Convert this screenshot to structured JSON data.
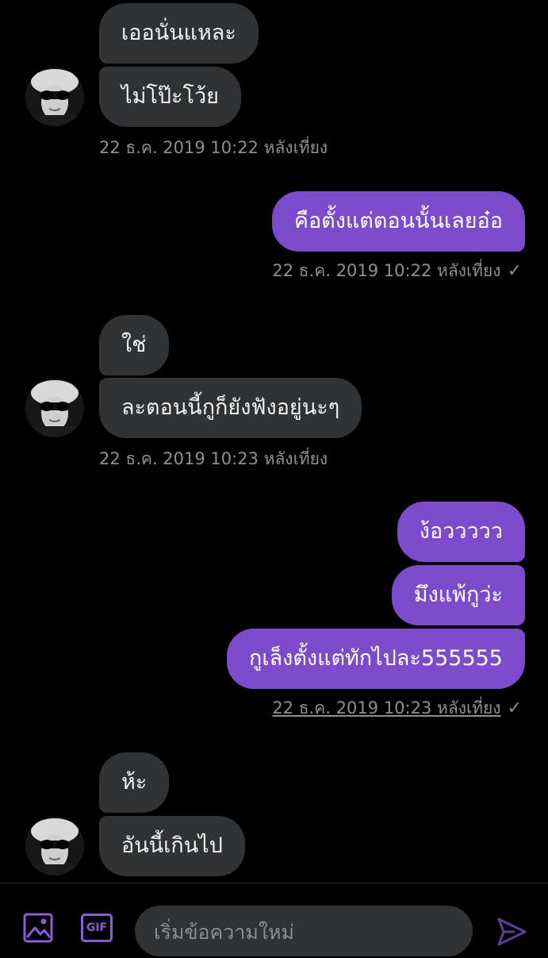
{
  "messages": [
    {
      "text": "เออนั่นแหละ"
    },
    {
      "text": "ไม่โป๊ะโว้ย"
    },
    {
      "text": "คือตั้งแต่ตอนนั้นเลยอ๋อ"
    },
    {
      "text": "ใช่"
    },
    {
      "text": "ละตอนนี้กูก็ยังฟังอยู่นะๆ"
    },
    {
      "text": "ง้อววววว"
    },
    {
      "text": "มึงแพ้กูว่ะ"
    },
    {
      "text": "กูเล็งตั้งแต่ทักไปละ555555"
    },
    {
      "text": "ห้ะ"
    },
    {
      "text": "อันนี้เกินไป"
    }
  ],
  "timestamps": [
    {
      "time": "22 ธ.ค. 2019 10:22 หลังเที่ยง"
    },
    {
      "time": "22 ธ.ค. 2019 10:22 หลังเที่ยง",
      "check": "✓"
    },
    {
      "time": "22 ธ.ค. 2019 10:23 หลังเที่ยง"
    },
    {
      "time": "22 ธ.ค. 2019 10:23 หลังเที่ยง",
      "check": "✓"
    }
  ],
  "composer": {
    "placeholder": "เริ่มข้อความใหม่",
    "gif_label": "GIF",
    "media_icon": "image-icon",
    "gif_icon": "gif-icon",
    "send_icon": "send-icon"
  },
  "colors": {
    "incoming_bubble": "#2f3336",
    "outgoing_bubble": "#7b4bcc",
    "accent": "#8a5cd6",
    "timestamp": "#8b8f94"
  }
}
